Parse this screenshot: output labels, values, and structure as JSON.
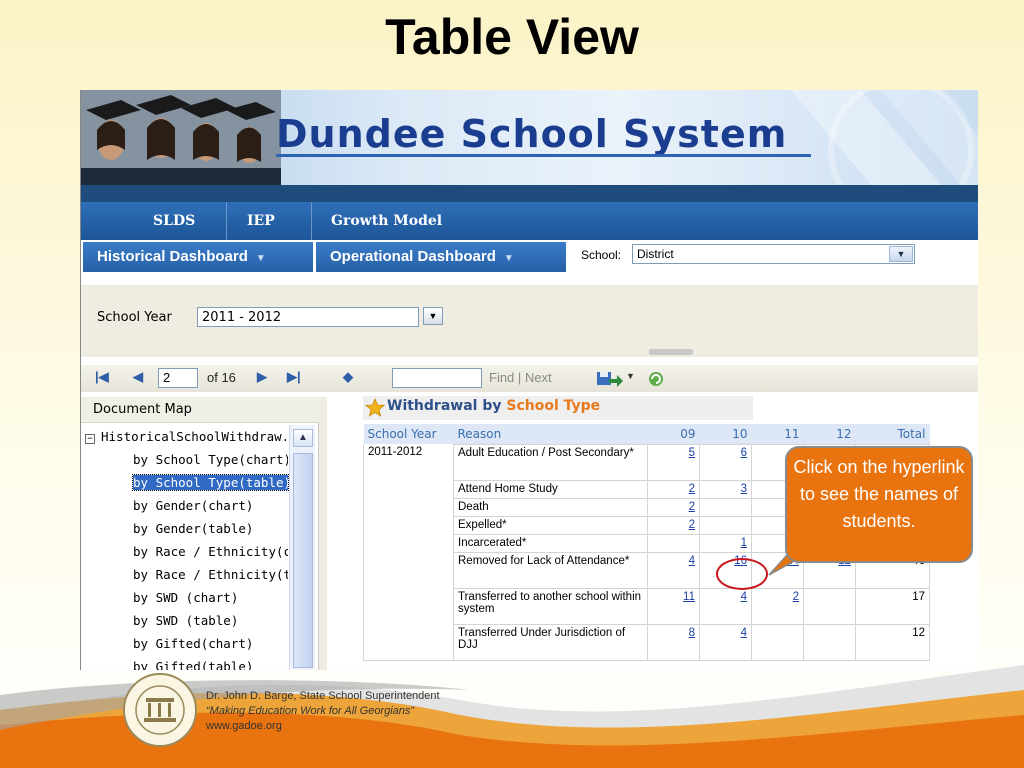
{
  "slide": {
    "title": "Table View"
  },
  "banner": {
    "title": "Dundee School System"
  },
  "nav": {
    "items": [
      "SLDS",
      "IEP",
      "Growth Model"
    ]
  },
  "dashboards": {
    "historical": "Historical Dashboard",
    "operational": "Operational Dashboard",
    "school_label": "School:",
    "school_value": "District"
  },
  "params": {
    "school_year_label": "School Year",
    "school_year_value": "2011 - 2012"
  },
  "toolbar": {
    "page_value": "2",
    "of_pages": "of 16",
    "find_label": "Find",
    "next_label": "Next",
    "find_separator": "|"
  },
  "docmap": {
    "header": "Document Map",
    "root": "HistoricalSchoolWithdraw.",
    "items": [
      "by School Type(chart)",
      "by School Type(table)",
      "by Gender(chart)",
      "by Gender(table)",
      "by Race / Ethnicity(ch",
      "by Race / Ethnicity(tab",
      "by SWD (chart)",
      "by SWD (table)",
      "by Gifted(chart)",
      "by Gifted(table)"
    ]
  },
  "report": {
    "title_prefix": "Withdrawal by",
    "title_highlight": "School Type",
    "columns": [
      "School Year",
      "Reason",
      "09",
      "10",
      "11",
      "12",
      "Total"
    ],
    "school_year": "2011-2012",
    "rows": [
      {
        "reason": "Adult Education / Post Secondary*",
        "c09": "5",
        "c10": "6",
        "c11": "",
        "c12": "",
        "total": ""
      },
      {
        "reason": "Attend Home Study",
        "c09": "2",
        "c10": "3",
        "c11": "",
        "c12": "",
        "total": ""
      },
      {
        "reason": "Death",
        "c09": "2",
        "c10": "",
        "c11": "",
        "c12": "",
        "total": ""
      },
      {
        "reason": "Expelled*",
        "c09": "2",
        "c10": "",
        "c11": "",
        "c12": "",
        "total": ""
      },
      {
        "reason": "Incarcerated*",
        "c09": "",
        "c10": "1",
        "c11": "",
        "c12": "",
        "total": ""
      },
      {
        "reason": "Removed for Lack of Attendance*",
        "c09": "4",
        "c10": "16",
        "c11": "14",
        "c12": "12",
        "total": "46"
      },
      {
        "reason": "Transferred to another school within system",
        "c09": "11",
        "c10": "4",
        "c11": "2",
        "c12": "",
        "total": "17"
      },
      {
        "reason": "Transferred Under Jurisdiction of DJJ",
        "c09": "8",
        "c10": "4",
        "c11": "",
        "c12": "",
        "total": "12"
      }
    ]
  },
  "callout": {
    "text": "Click on the hyperlink to see the names of students."
  },
  "footer": {
    "line1": "Dr. John D. Barge, State School Superintendent",
    "line2": "“Making Education Work for All Georgians”",
    "line3": "www.gadoe.org"
  },
  "colors": {
    "accent_orange": "#e8730f",
    "nav_blue": "#1d5598",
    "link_blue": "#1a3fa8",
    "highlight_red": "#c9171d"
  }
}
